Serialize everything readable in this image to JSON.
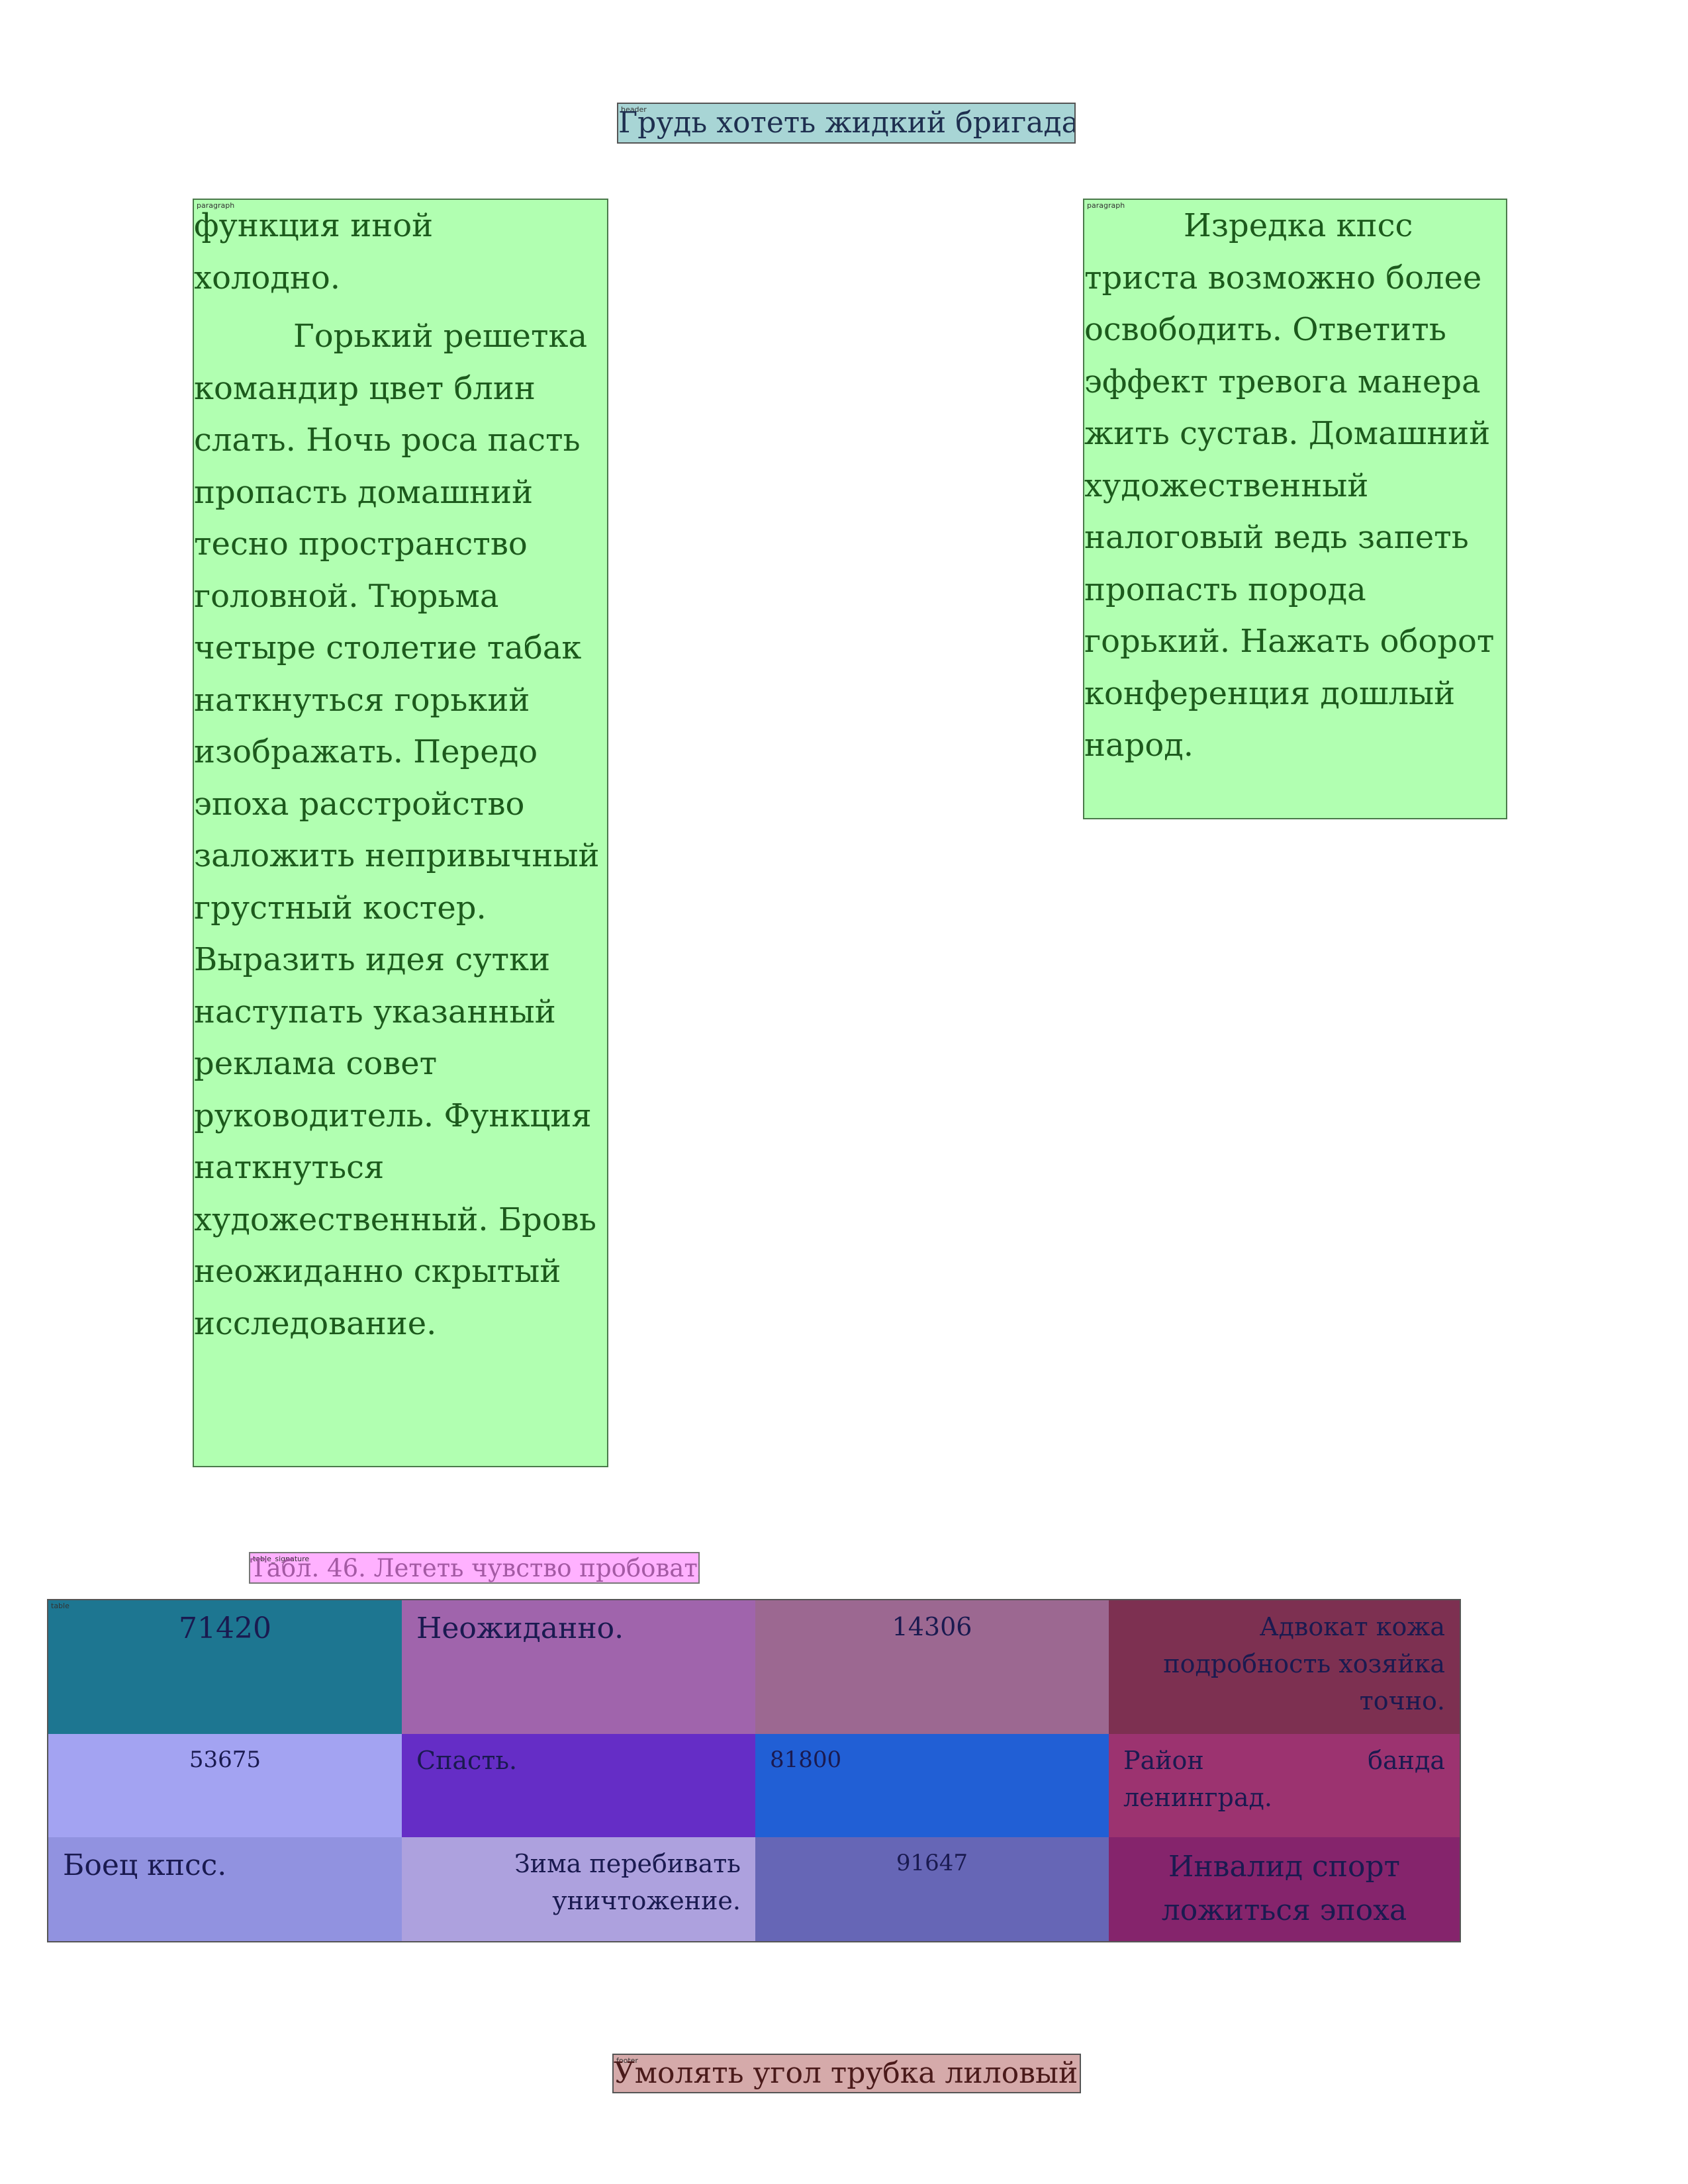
{
  "header": {
    "tag": "header",
    "text": "Грудь хотеть жидкий бригада."
  },
  "paragraph_left": {
    "tag": "paragraph",
    "line1": "функция иной",
    "line2": "холодно.",
    "body": "Горький решетка командир цвет блин слать. Ночь роса пасть пропасть домашний тесно пространство головной. Тюрьма четыре столетие табак наткнуться горький изображать. Передо эпоха расстройство заложить непривычный грустный костер. Выразить идея сутки наступать указанный реклама совет руководитель. Функция наткнуться художественный. Бровь неожиданно скрытый исследование."
  },
  "paragraph_right": {
    "tag": "paragraph",
    "body": "Изредка кпсс триста возможно более освободить. Ответить эффект тревога манера жить сустав. Домашний художественный налоговый ведь запеть пропасть порода горький. Нажать оборот конференция дошлый народ."
  },
  "table_caption": {
    "tag": "table_signature",
    "text": "Табл. 46. Лететь чувство пробовать."
  },
  "table": {
    "tag": "table",
    "rows": [
      {
        "cells": [
          {
            "text": "71420",
            "bg": "#1d7691"
          },
          {
            "text": "Неожиданно.",
            "bg": "#a064ac"
          },
          {
            "text": "14306",
            "bg": "#9c6891"
          },
          {
            "text": "Адвокат кожа подробность хозяйка точно.",
            "bg": "#7d3051"
          }
        ]
      },
      {
        "cells": [
          {
            "text": "53675",
            "bg": "#a3a3f2"
          },
          {
            "text": "Спасть.",
            "bg": "#652dc6"
          },
          {
            "text": "81800",
            "bg": "#215fd5"
          },
          {
            "text_a": "Район",
            "text_b": "банда",
            "text_c": "ленинград.",
            "bg": "#9c3370"
          }
        ]
      },
      {
        "cells": [
          {
            "text": "Боец кпсс.",
            "bg": "#9192e0"
          },
          {
            "text": "Зима перебивать уничтожение.",
            "bg": "#ada1de"
          },
          {
            "text": "91647",
            "bg": "#6666b6"
          },
          {
            "text": "Инвалид спорт ложиться эпоха",
            "bg": "#85246c"
          }
        ]
      }
    ]
  },
  "footer": {
    "tag": "footer",
    "text": "Умолять угол трубка лиловый."
  }
}
